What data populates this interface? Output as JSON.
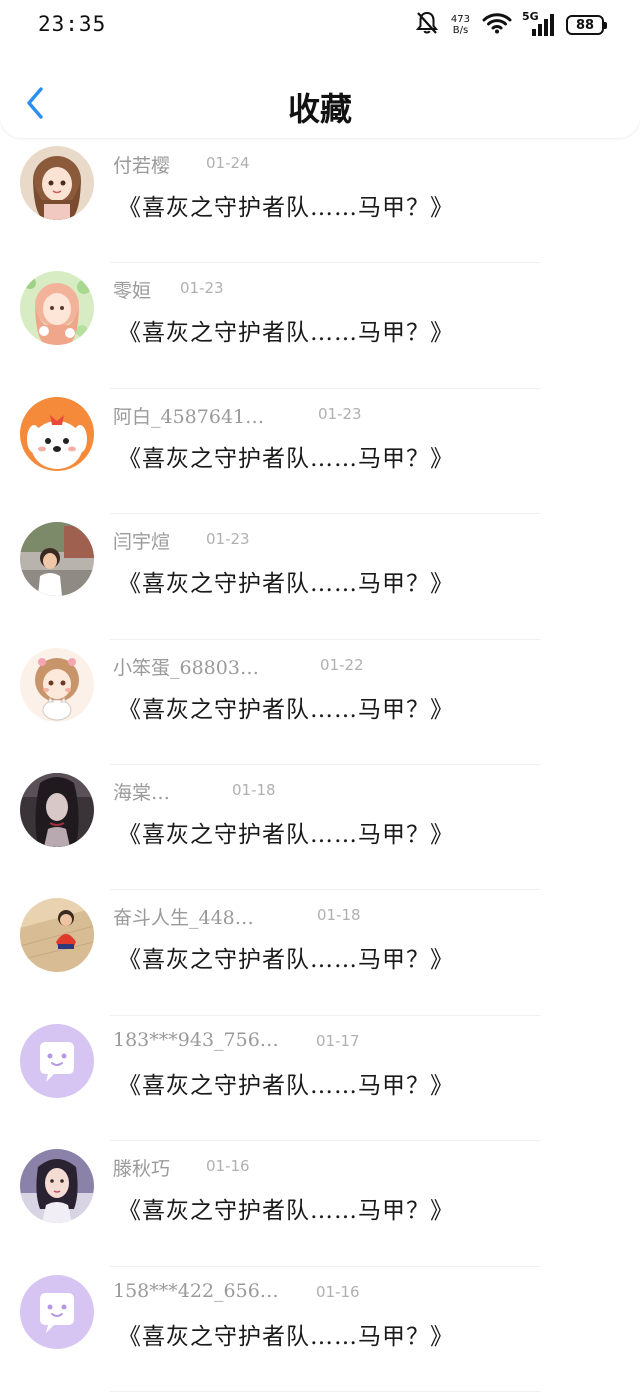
{
  "status_bar": {
    "time": "23:35",
    "net_speed_value": "473",
    "net_speed_unit": "B/s",
    "network_type": "5G",
    "battery": "88"
  },
  "nav": {
    "back_icon": "chevron-left-icon",
    "title": "收藏",
    "accent_color": "#2a8ff0"
  },
  "items": [
    {
      "username": "付若樱",
      "date": "01-24",
      "title": "《喜灰之守护者队……马甲？》",
      "avatar": "anime-girl"
    },
    {
      "username": "零姮",
      "date": "01-23",
      "title": "《喜灰之守护者队……马甲？》",
      "avatar": "anime-flower-girl"
    },
    {
      "username": "阿白_4587641…",
      "date": "01-23",
      "title": "《喜灰之守护者队……马甲？》",
      "avatar": "cartoon-dog"
    },
    {
      "username": "闫宇煊",
      "date": "01-23",
      "title": "《喜灰之守护者队……马甲？》",
      "avatar": "child-photo"
    },
    {
      "username": "小笨蛋_68803…",
      "date": "01-22",
      "title": "《喜灰之守护者队……马甲？》",
      "avatar": "anime-girl-cat"
    },
    {
      "username": "海棠…",
      "date": "01-18",
      "title": "《喜灰之守护者队……马甲？》",
      "avatar": "dark-anime"
    },
    {
      "username": "奋斗人生_448…",
      "date": "01-18",
      "title": "《喜灰之守护者队……马甲？》",
      "avatar": "baby-photo"
    },
    {
      "username": "183***943_756…",
      "date": "01-17",
      "title": "《喜灰之守护者队……马甲？》",
      "avatar": "default-chat"
    },
    {
      "username": "滕秋巧",
      "date": "01-16",
      "title": "《喜灰之守护者队……马甲？》",
      "avatar": "woman-photo"
    },
    {
      "username": "158***422_656…",
      "date": "01-16",
      "title": "《喜灰之守护者队……马甲？》",
      "avatar": "default-chat"
    }
  ]
}
